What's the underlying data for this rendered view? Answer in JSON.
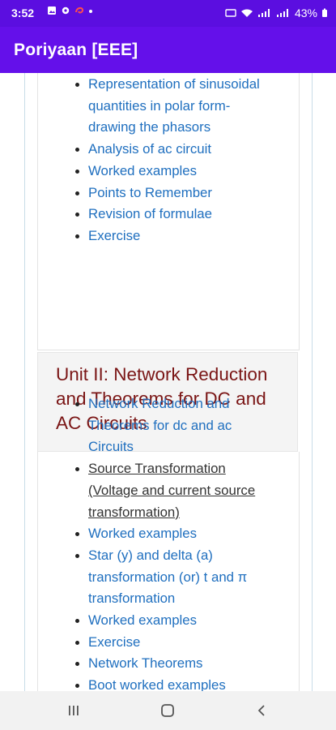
{
  "status_bar": {
    "time": "3:52",
    "battery": "43%"
  },
  "app_bar": {
    "title": "Poriyaan [EEE]"
  },
  "unit1_topics": [
    "Representation of sinusoidal quantities in polar form- drawing the phasors",
    "Analysis of ac circuit",
    "Worked examples",
    "Points to Remember",
    "Revision of formulae",
    "Exercise"
  ],
  "unit2": {
    "title": "Unit II: Network Reduction and Theorems for DC and AC Circuits",
    "topics": [
      "Network Reduction and Theorems for dc and ac Circuits",
      "Source Transformation (Voltage and current source transformation)",
      "Worked examples",
      "Star (y) and delta (a) transformation (or) t and π transformation",
      "Worked examples",
      "Exercise",
      "Network Theorems",
      "Boot worked examples"
    ]
  },
  "colors": {
    "primary": "#6410ea",
    "status_bar": "#5b0ee0",
    "link": "#1f6fbf",
    "heading": "#7a1515"
  },
  "icons": {
    "recents": "recents-icon",
    "home": "home-icon",
    "back": "back-icon"
  }
}
